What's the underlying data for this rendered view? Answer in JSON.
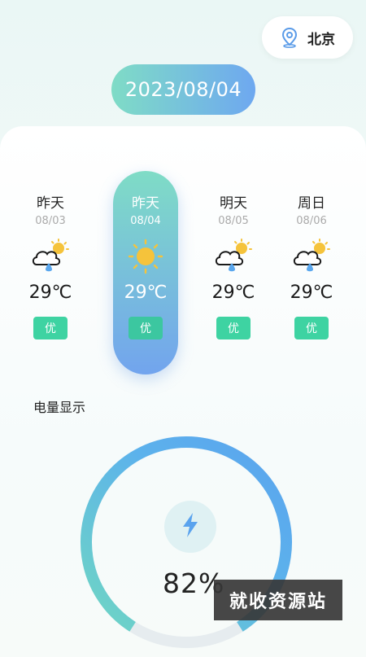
{
  "location": {
    "label": "北京",
    "icon": "location-pin-icon"
  },
  "date": "2023/08/04",
  "days": [
    {
      "name": "昨天",
      "date": "08/03",
      "icon": "cloud-sun-rain-icon",
      "temp": "29℃",
      "aqi": "优",
      "selected": false
    },
    {
      "name": "昨天",
      "date": "08/04",
      "icon": "sun-icon",
      "temp": "29℃",
      "aqi": "优",
      "selected": true
    },
    {
      "name": "明天",
      "date": "08/05",
      "icon": "cloud-sun-rain-icon",
      "temp": "29℃",
      "aqi": "优",
      "selected": false
    },
    {
      "name": "周日",
      "date": "08/06",
      "icon": "cloud-sun-rain-icon",
      "temp": "29℃",
      "aqi": "优",
      "selected": false
    }
  ],
  "battery": {
    "title": "电量显示",
    "percent_label": "82%",
    "level": 0.82,
    "icon": "lightning-bolt-icon"
  },
  "watermark": "就收资源站",
  "colors": {
    "accent_teal": "#7fdcc6",
    "accent_blue": "#6ea8f0",
    "badge_green": "#3ed3a2"
  }
}
